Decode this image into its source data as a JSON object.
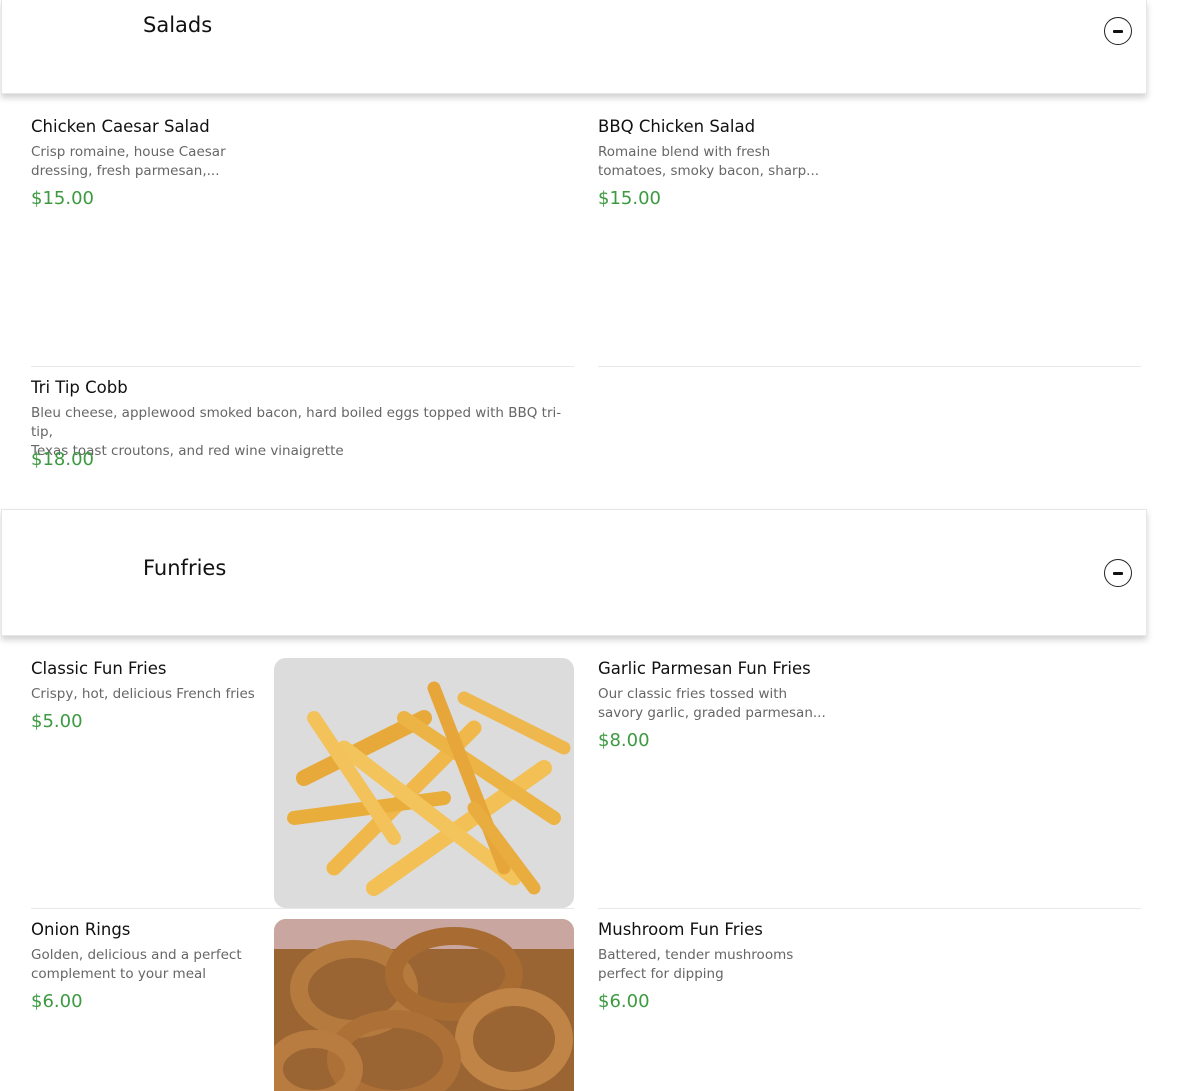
{
  "sections": [
    {
      "title": "Salads",
      "items": [
        {
          "name": "Chicken Caesar Salad",
          "desc_lines": [
            "Crisp romaine, house Caesar",
            "dressing, fresh parmesan,..."
          ],
          "price": "$15.00"
        },
        {
          "name": "BBQ Chicken Salad",
          "desc_lines": [
            "Romaine blend with fresh",
            "tomatoes, smoky bacon, sharp..."
          ],
          "price": "$15.00"
        },
        {
          "name": "Tri Tip Cobb",
          "desc_lines": [
            "Bleu cheese, applewood smoked bacon, hard boiled eggs topped with BBQ tri-tip,",
            "Texas toast croutons, and red wine vinaigrette"
          ],
          "price": "$18.00"
        }
      ]
    },
    {
      "title": "Funfries",
      "items": [
        {
          "name": "Classic Fun Fries",
          "desc_lines": [
            "Crispy, hot, delicious French fries"
          ],
          "price": "$5.00",
          "photo": "french-fries-photo"
        },
        {
          "name": "Garlic Parmesan Fun Fries",
          "desc_lines": [
            "Our classic fries tossed with",
            "savory garlic, graded parmesan..."
          ],
          "price": "$8.00"
        },
        {
          "name": "Onion Rings",
          "desc_lines": [
            "Golden, delicious and a perfect",
            "complement to your meal"
          ],
          "price": "$6.00",
          "photo": "onion-rings-photo"
        },
        {
          "name": "Mushroom Fun Fries",
          "desc_lines": [
            "Battered, tender mushrooms",
            "perfect for dipping"
          ],
          "price": "$6.00"
        }
      ]
    }
  ],
  "icons": {
    "collapse": "minus-circle-icon"
  },
  "colors": {
    "price": "#3d9a41",
    "description": "#666666",
    "divider": "#e8e8e8"
  }
}
